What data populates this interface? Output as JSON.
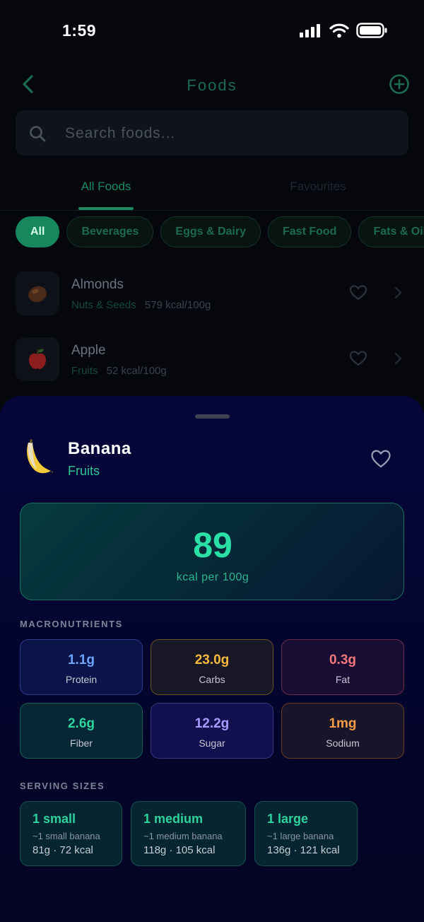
{
  "status_bar": {
    "time": "1:59"
  },
  "header": {
    "title": "Foods"
  },
  "search": {
    "placeholder": "Search foods..."
  },
  "tabs": [
    {
      "label": "All Foods",
      "active": true
    },
    {
      "label": "Favourites",
      "active": false
    }
  ],
  "chips": [
    {
      "label": "All",
      "active": true
    },
    {
      "label": "Beverages",
      "active": false
    },
    {
      "label": "Eggs & Dairy",
      "active": false
    },
    {
      "label": "Fast Food",
      "active": false
    },
    {
      "label": "Fats & Oils",
      "active": false
    }
  ],
  "food_list": [
    {
      "name": "Almonds",
      "category": "Nuts & Seeds",
      "kcal": "579 kcal/100g",
      "icon": "almond-icon"
    },
    {
      "name": "Apple",
      "category": "Fruits",
      "kcal": "52 kcal/100g",
      "icon": "apple-icon"
    }
  ],
  "detail": {
    "name": "Banana",
    "category": "Fruits",
    "icon": "banana-icon",
    "kcal_value": "89",
    "kcal_label": "kcal per 100g",
    "macros_label": "MACRONUTRIENTS",
    "macros": [
      {
        "value": "1.1g",
        "label": "Protein",
        "color": "#6ea2ff"
      },
      {
        "value": "23.0g",
        "label": "Carbs",
        "color": "#f5b93b"
      },
      {
        "value": "0.3g",
        "label": "Fat",
        "color": "#f2787a"
      },
      {
        "value": "2.6g",
        "label": "Fiber",
        "color": "#2fd3a0"
      },
      {
        "value": "12.2g",
        "label": "Sugar",
        "color": "#a89aff"
      },
      {
        "value": "1mg",
        "label": "Sodium",
        "color": "#f59a45"
      }
    ],
    "servings_label": "SERVING SIZES",
    "servings": [
      {
        "title": "1 small",
        "desc": "~1 small banana",
        "info": "81g · 72 kcal"
      },
      {
        "title": "1 medium",
        "desc": "~1 medium banana",
        "info": "118g · 105 kcal"
      },
      {
        "title": "1 large",
        "desc": "~1 large banana",
        "info": "136g · 121 kcal"
      }
    ]
  },
  "colors": {
    "accent": "#2be0a6",
    "sheet_bg": "#05053a"
  }
}
